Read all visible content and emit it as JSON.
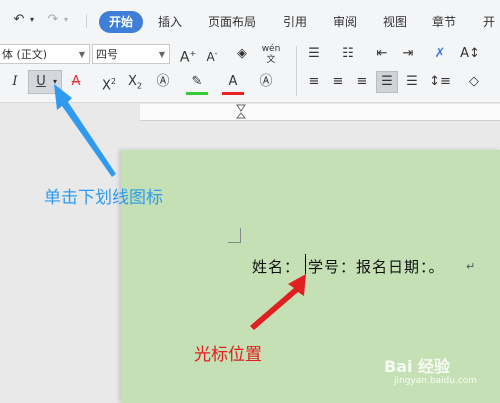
{
  "tabs": {
    "active": "开始",
    "items": [
      "插入",
      "页面布局",
      "引用",
      "审阅",
      "视图",
      "章节",
      "开"
    ]
  },
  "ribbon": {
    "font_name": "体 (正文)",
    "font_size": "四号",
    "phonetic_icon_text": "wén"
  },
  "document": {
    "line_text_before_cursor": "姓名：",
    "line_text_after_cursor": "学号：报名日期：。",
    "paragraph_mark": "↵"
  },
  "annotations": {
    "underline_hint": "单击下划线图标",
    "cursor_hint": "光标位置",
    "hint_color": "#2e9bf0",
    "cursor_hint_color": "#e02020"
  },
  "watermark": {
    "brand": "Bai 经验",
    "url": "jingyan.baidu.com"
  },
  "icons": [
    "undo-icon",
    "redo-icon",
    "grow-font-icon",
    "shrink-font-icon",
    "clear-format-icon",
    "phonetic-icon",
    "bullet-list-icon",
    "numbered-list-icon",
    "decrease-indent-icon",
    "increase-indent-icon",
    "text-direction-icon",
    "italic-icon",
    "underline-icon",
    "strikethrough-icon",
    "superscript-icon",
    "subscript-icon",
    "text-effect-icon",
    "highlight-icon",
    "font-color-icon",
    "char-border-icon",
    "align-left-icon",
    "align-center-icon",
    "align-right-icon",
    "justify-icon",
    "distributed-icon",
    "line-spacing-icon",
    "shading-icon"
  ]
}
